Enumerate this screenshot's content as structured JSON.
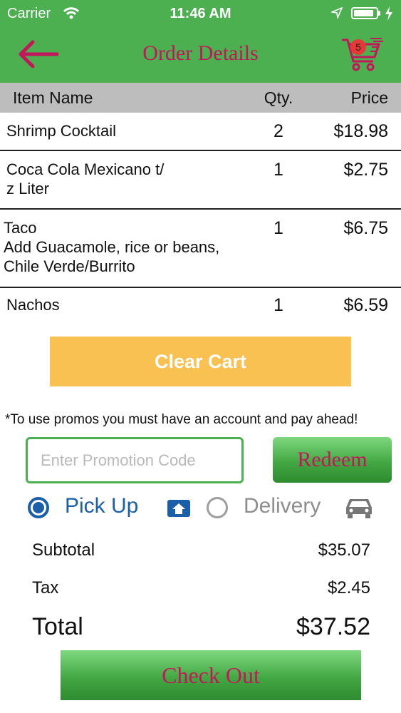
{
  "status_bar": {
    "carrier": "Carrier",
    "time": "11:46 AM",
    "battery_level_pct": 90
  },
  "nav": {
    "title": "Order Details",
    "cart_count": "5"
  },
  "table": {
    "headers": {
      "item": "Item Name",
      "qty": "Qty.",
      "price": "Price"
    },
    "rows": [
      {
        "name": "Shrimp Cocktail",
        "qty": "2",
        "price": "$18.98"
      },
      {
        "name": "Coca Cola Mexicano t/\nz Liter",
        "qty": "1",
        "price": "$2.75"
      },
      {
        "name": "Taco\nAdd Guacamole, rice or beans,\nChile Verde/Burrito",
        "qty": "1",
        "price": "$6.75"
      },
      {
        "name": "Nachos",
        "qty": "1",
        "price": "$6.59"
      }
    ]
  },
  "clear_cart_label": "Clear Cart",
  "promo": {
    "note": "*To use promos you must have an account and pay ahead!",
    "placeholder": "Enter Promotion Code",
    "value": "",
    "redeem_label": "Redeem"
  },
  "order_type": {
    "pickup_label": "Pick Up",
    "delivery_label": "Delivery",
    "selected": "Pick Up"
  },
  "summary": {
    "subtotal_label": "Subtotal",
    "subtotal": "$35.07",
    "tax_label": "Tax",
    "tax": "$2.45",
    "total_label": "Total",
    "total": "$37.52"
  },
  "checkout_label": "Check Out",
  "colors": {
    "accent_green": "#4caf50",
    "title_pink": "#c2185b",
    "clear_orange": "#f9c152",
    "radio_blue": "#1a5fa8"
  },
  "icons": {
    "back": "arrow-left-icon",
    "cart": "shopping-cart-icon",
    "store": "store-icon",
    "car": "car-icon"
  }
}
